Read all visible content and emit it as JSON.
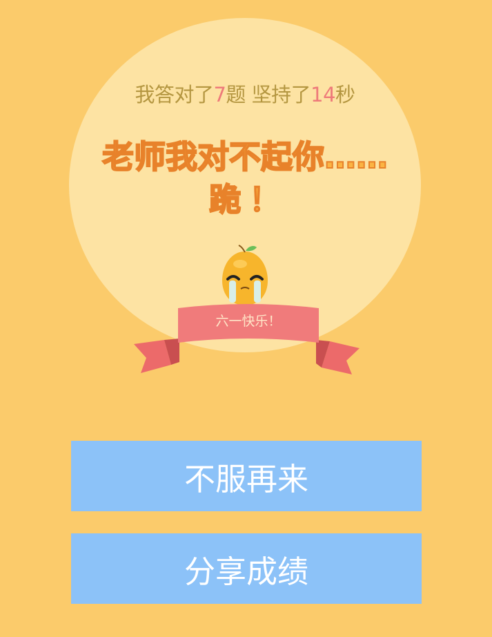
{
  "result": {
    "prefix": "我答对了",
    "correct_count": "7",
    "mid": "题 坚持了",
    "seconds": "14",
    "suffix": "秒"
  },
  "verdict": {
    "line1": "老师我对不起你……",
    "line2": "跪！"
  },
  "banner": {
    "label": "六一快乐！"
  },
  "buttons": {
    "retry_label": "不服再来",
    "share_label": "分享成绩"
  },
  "colors": {
    "background": "#fbcb6b",
    "circle": "#fde3a3",
    "stat_text": "#b49640",
    "stat_highlight": "#ee7a7a",
    "verdict_fill": "#fbb443",
    "verdict_stroke": "#e8822a",
    "ribbon": "#f08080",
    "button": "#8cc2f8"
  },
  "icons": {
    "mascot": "crying-orange-mascot-icon",
    "ribbon": "ribbon-banner-icon"
  }
}
